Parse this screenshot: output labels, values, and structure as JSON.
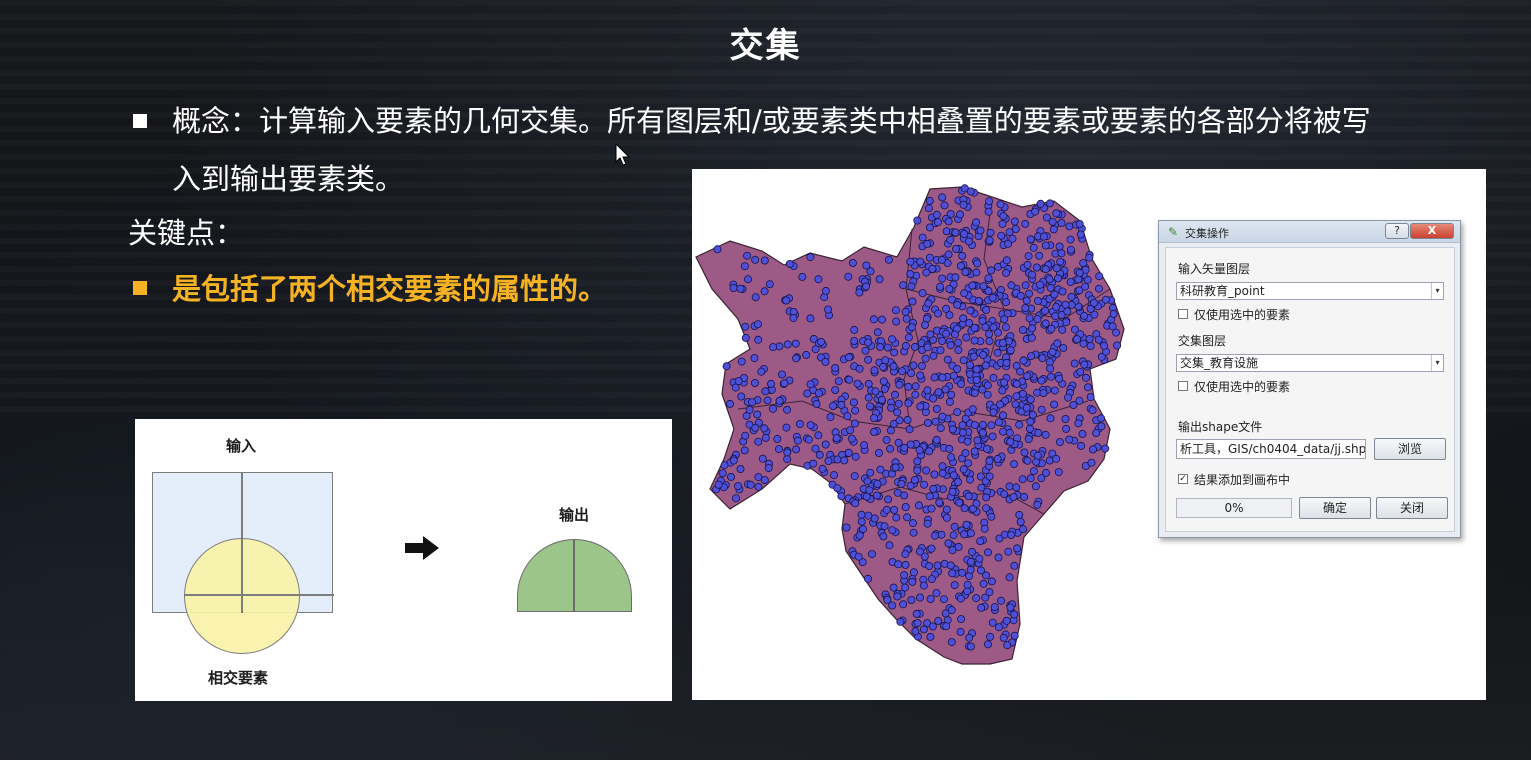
{
  "slide": {
    "title": "交集",
    "concept_line1": "概念：计算输入要素的几何交集。所有图层和/或要素类中相叠置的要素或要素的各部分将被写",
    "concept_line2": "入到输出要素类。",
    "key_points_label": "关键点：",
    "key_point_1": "是包括了两个相交要素的属性的。",
    "accent_color": "#f5b324"
  },
  "venn_diagram": {
    "input_label": "输入",
    "output_label": "输出",
    "intersect_label": "相交要素",
    "arrow_icon": "arrow-right-icon"
  },
  "dialog": {
    "title": "交集操作",
    "app_icon": "qgis-icon",
    "help_button": "?",
    "close_button": "X",
    "input_layer_label": "输入矢量图层",
    "input_layer_value": "科研教育_point",
    "use_selected_1_label": "仅使用选中的要素",
    "use_selected_1_checked": false,
    "intersect_layer_label": "交集图层",
    "intersect_layer_value": "交集_教育设施",
    "use_selected_2_label": "仅使用选中的要素",
    "use_selected_2_checked": false,
    "output_label": "输出shape文件",
    "output_value": "析工具，GIS/ch0404_data/jj.shp",
    "browse_button": "浏览",
    "add_to_canvas_label": "结果添加到画布中",
    "add_to_canvas_checked": true,
    "progress_text": "0%",
    "ok_button": "确定",
    "close_dialog_button": "关闭"
  },
  "colors": {
    "region_fill": "#9e5a87",
    "point_fill": "#4f4fd8",
    "venn_square": "#e4eefb",
    "venn_circle": "#faf2a8",
    "venn_output": "#9cc58a"
  }
}
